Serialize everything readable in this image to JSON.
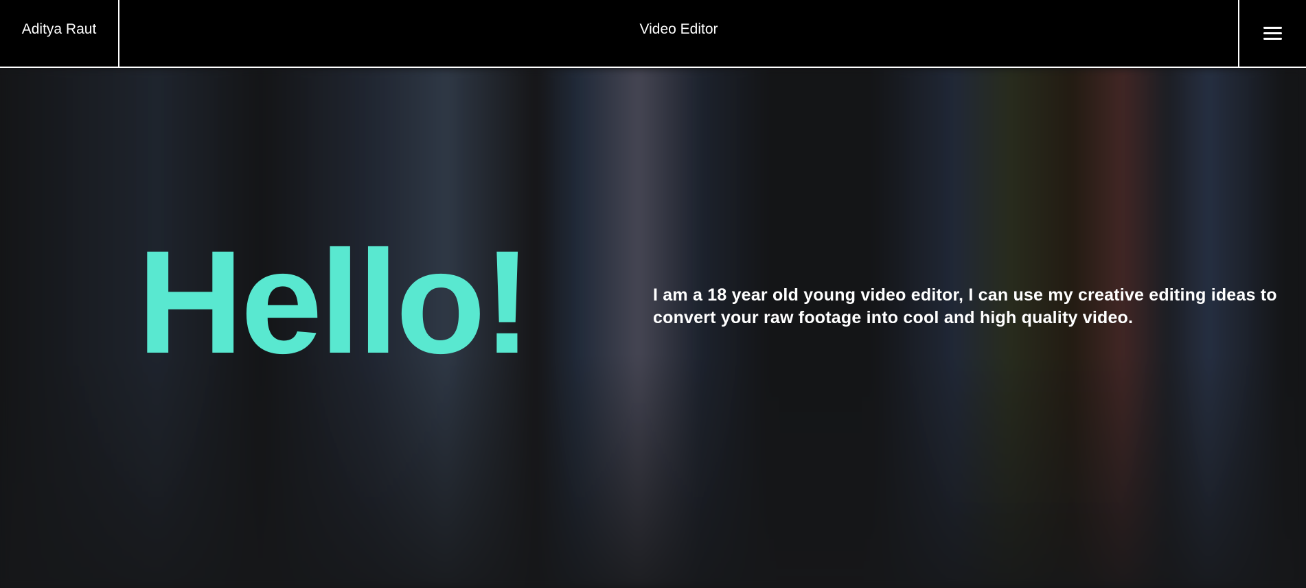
{
  "header": {
    "brand": "Aditya Raut",
    "title": "Video Editor",
    "menu_icon": "hamburger-menu-icon"
  },
  "hero": {
    "heading": "Hello!",
    "intro": "I am a 18 year old young video editor, I can use my creative editing ideas to convert your raw footage into cool and high quality video."
  },
  "colors": {
    "accent": "#59e8d0",
    "header_bg": "#000000",
    "hero_bg": "#141517",
    "text": "#ffffff"
  }
}
